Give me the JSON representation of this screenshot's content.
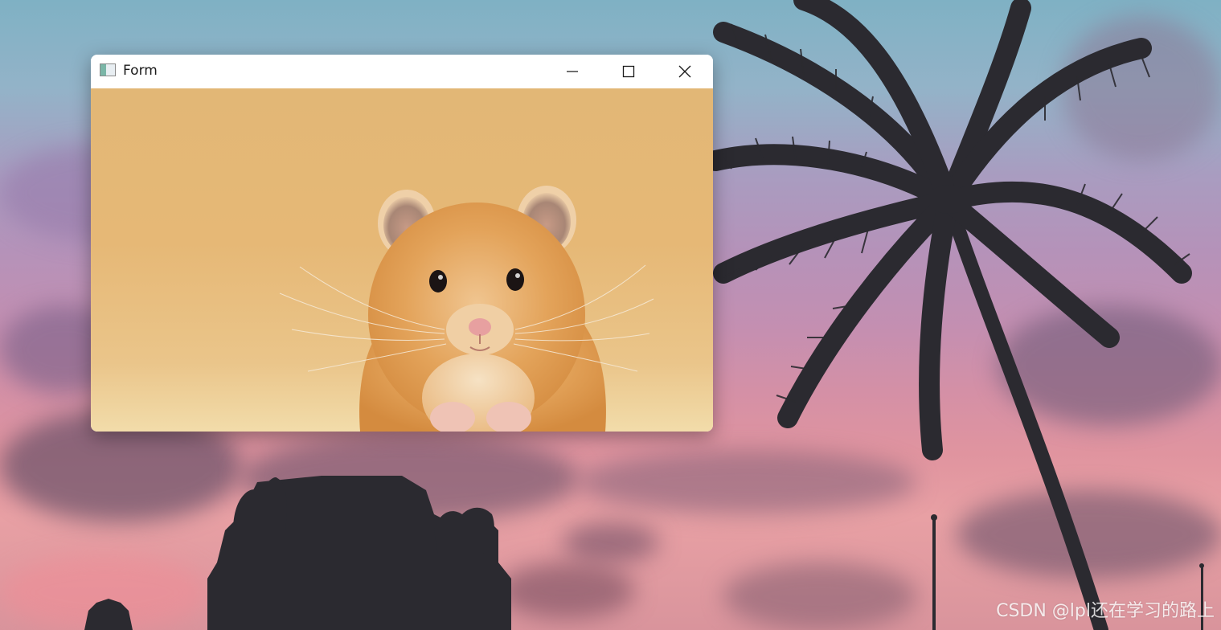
{
  "window": {
    "title": "Form",
    "icon": "app-window-icon",
    "controls": {
      "minimize": "minimize-icon",
      "maximize": "maximize-icon",
      "close": "close-icon"
    }
  },
  "client": {
    "image": "hamster-photo"
  },
  "desktop": {
    "wallpaper": "sunset-palm-silhouette",
    "watermark": "CSDN @lpl还在学习的路上"
  },
  "colors": {
    "titlebar": "#ffffff",
    "client_background": "#e2b776",
    "hamster_fur": "#e0a458",
    "sky_top": "#7fb1c4",
    "sky_bottom": "#e8a0a4",
    "silhouette": "#2b2a30"
  }
}
